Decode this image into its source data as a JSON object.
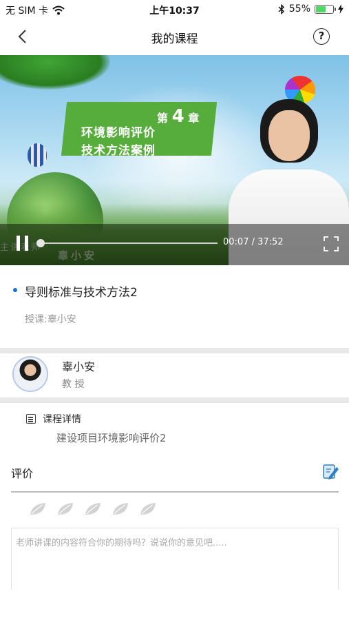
{
  "status_bar": {
    "carrier": "无 SIM 卡",
    "time": "上午10:37",
    "battery_percent": "55%",
    "battery_level": 0.55
  },
  "nav": {
    "title": "我的课程"
  },
  "video": {
    "chapter_label": "第",
    "chapter_number": "4",
    "chapter_suffix": "章",
    "chapter_title_line1": "环境影响评价",
    "chapter_title_line2": "技术方法案例",
    "lecturer_overlay": "主讲老师",
    "lecturer_name_overlay": "辜小安",
    "current_time": "00:07",
    "total_time": "37:52",
    "time_separator": " / ",
    "progress": 0.003
  },
  "lesson": {
    "title": "导则标准与技术方法2",
    "teacher": "授课:辜小安"
  },
  "teacher": {
    "name": "辜小安",
    "title": "教 授"
  },
  "detail": {
    "label": "课程详情",
    "value": "建设项目环境影响评价2"
  },
  "rating": {
    "label": "评价",
    "leaf_count": 5,
    "selected": 0,
    "comment_placeholder": "老师讲课的内容符合你的期待吗？说说你的意见吧....."
  },
  "colors": {
    "accent_blue": "#1a6fd6",
    "leaf_gray": "#d3d3d3",
    "chapter_green": "#56ad3b"
  },
  "icons": [
    "wifi-icon",
    "bluetooth-icon",
    "battery-icon",
    "charging-icon",
    "back-arrow-icon",
    "help-icon",
    "pause-icon",
    "fullscreen-icon",
    "course-detail-icon",
    "edit-review-icon",
    "leaf-rating-icon"
  ]
}
